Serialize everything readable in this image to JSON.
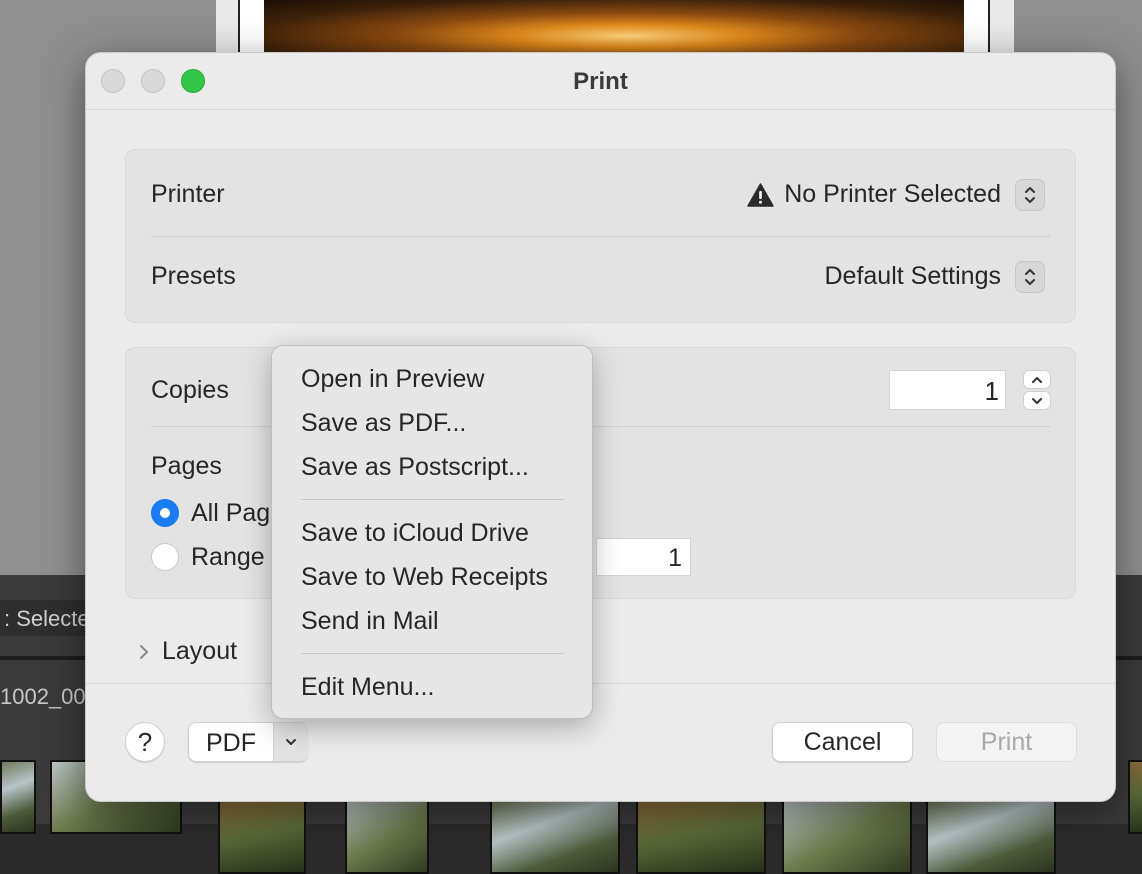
{
  "background": {
    "strip_text": "Selecte",
    "strip_text_prefix": ":",
    "filename_fragment": "1002_00"
  },
  "dialog": {
    "title": "Print",
    "printer": {
      "label": "Printer",
      "value": "No Printer Selected",
      "warning_icon": "warning-triangle-icon"
    },
    "presets": {
      "label": "Presets",
      "value": "Default Settings"
    },
    "copies": {
      "label": "Copies",
      "value": "1"
    },
    "pages": {
      "label": "Pages",
      "options": [
        {
          "label": "All Pag",
          "selected": true
        },
        {
          "label": "Range",
          "selected": false
        }
      ],
      "range_to": "1"
    },
    "layout_label": "Layout",
    "footer": {
      "help_label": "?",
      "pdf_label": "PDF",
      "cancel_label": "Cancel",
      "print_label": "Print"
    }
  },
  "pdf_menu": {
    "group1": [
      "Open in Preview",
      "Save as PDF...",
      "Save as Postscript..."
    ],
    "group2": [
      "Save to iCloud Drive",
      "Save to Web Receipts",
      "Send in Mail"
    ],
    "group3": [
      "Edit Menu..."
    ]
  },
  "colors": {
    "accent": "#1a7cf5",
    "zoom_button": "#33c748",
    "dialog_bg": "#ebebeb"
  }
}
